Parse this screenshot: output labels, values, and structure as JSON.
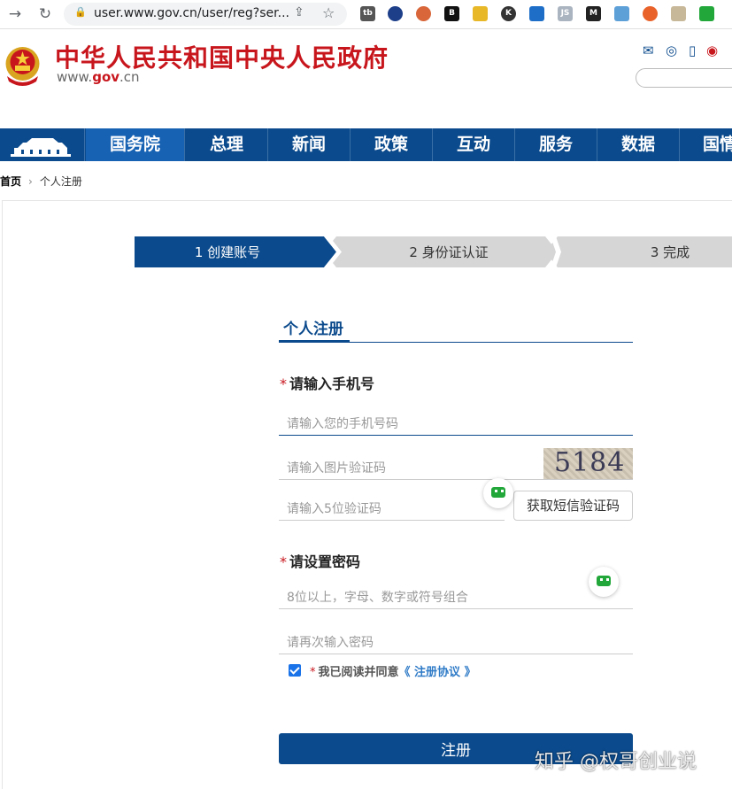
{
  "browser": {
    "url": "user.www.gov.cn/user/reg?ser...",
    "extensions": [
      "tb",
      "",
      "",
      "",
      "",
      "K",
      "",
      "JS",
      "M",
      "",
      "",
      "",
      ""
    ]
  },
  "header": {
    "title": "中华人民共和国中央人民政府",
    "domain_prefix": "www.",
    "domain_mid": "gov",
    "domain_suffix": ".cn"
  },
  "nav": {
    "items": [
      "国务院",
      "总理",
      "新闻",
      "政策",
      "互动",
      "服务",
      "数据",
      "国情"
    ]
  },
  "breadcrumb": {
    "home": "首页",
    "separator": "›",
    "current": "个人注册"
  },
  "steps": [
    "1 创建账号",
    "2 身份证认证",
    "3 完成"
  ],
  "form": {
    "title": "个人注册",
    "phone_section": "请输入手机号",
    "required_mark": "*",
    "phone_placeholder": "请输入您的手机号码",
    "image_code_placeholder": "请输入图片验证码",
    "captcha_text": "5184",
    "sms_code_placeholder": "请输入5位验证码",
    "sms_button": "获取短信验证码",
    "password_section": "请设置密码",
    "password_placeholder": "8位以上，字母、数字或符号组合",
    "password_confirm_placeholder": "请再次输入密码",
    "agree_text": "我已阅读并同意",
    "agree_link": "《 注册协议 》",
    "submit": "注册"
  },
  "watermark": "知乎 @权哥创业说",
  "colors": {
    "brand_red": "#c8161d",
    "nav_blue": "#0b4a8c",
    "nav_active": "#1762b3",
    "step_inactive": "#d6d6d6"
  }
}
